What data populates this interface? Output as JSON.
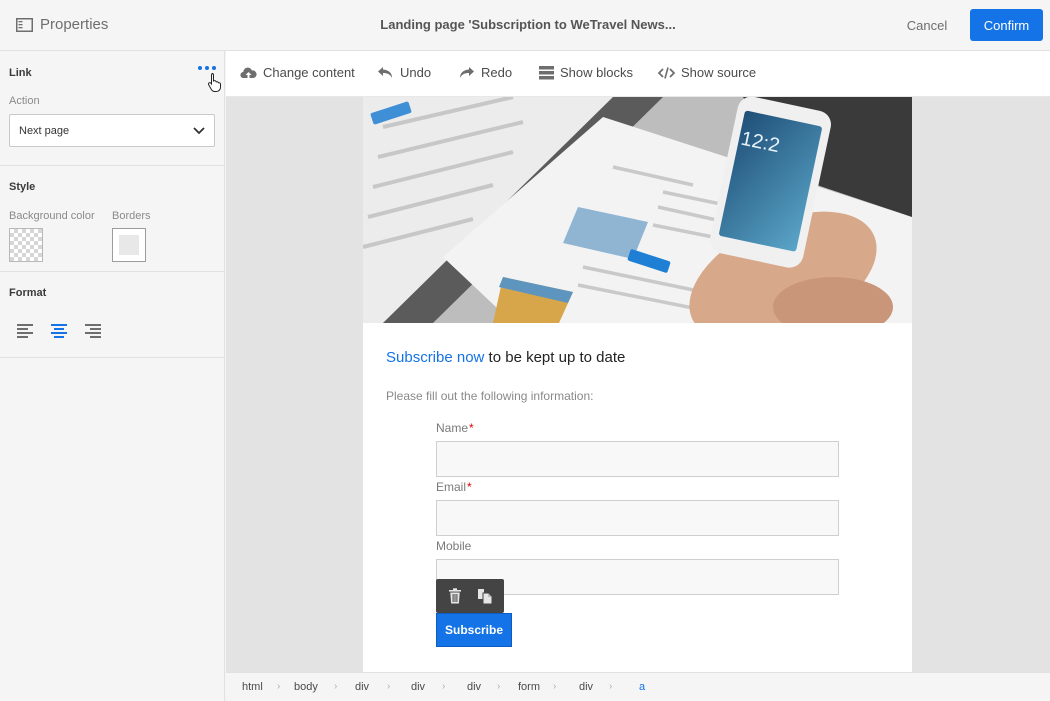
{
  "header": {
    "properties_title": "Properties",
    "page_title": "Landing page 'Subscription to WeTravel News...",
    "cancel_label": "Cancel",
    "confirm_label": "Confirm"
  },
  "panel": {
    "link": {
      "title": "Link",
      "action_label": "Action",
      "action_value": "Next page"
    },
    "style": {
      "title": "Style",
      "bg_color_label": "Background color",
      "borders_label": "Borders"
    },
    "format": {
      "title": "Format",
      "selected_alignment": "center"
    }
  },
  "toolbar": {
    "change_content": "Change content",
    "undo": "Undo",
    "redo": "Redo",
    "show_blocks": "Show blocks",
    "show_source": "Show source"
  },
  "content": {
    "heading_accent": "Subscribe now",
    "heading_rest": " to be kept up to date",
    "intro": "Please fill out the following information:",
    "fields": {
      "name_label": "Name",
      "email_label": "Email",
      "mobile_label": "Mobile",
      "required_mark": "*"
    },
    "subscribe_label": "Subscribe"
  },
  "breadcrumb": [
    "html",
    "body",
    "div",
    "div",
    "div",
    "form",
    "div",
    "a"
  ],
  "colors": {
    "accent": "#1473e6",
    "required": "#e60000"
  }
}
